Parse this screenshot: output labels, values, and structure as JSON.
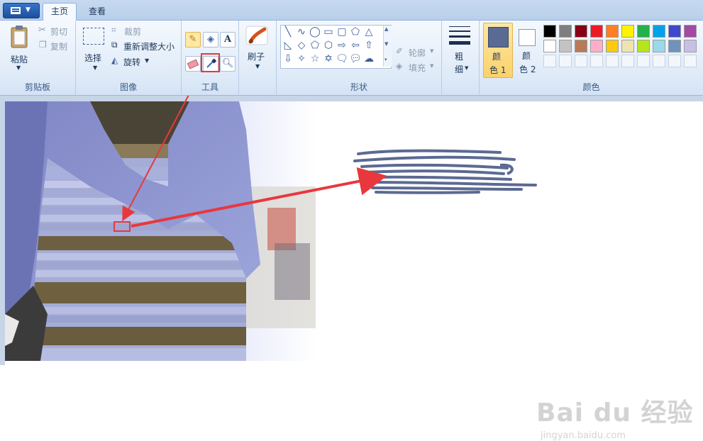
{
  "tabs": [
    {
      "label": "主页",
      "active": true
    },
    {
      "label": "查看",
      "active": false
    }
  ],
  "clipboard": {
    "paste": "粘贴",
    "cut": "剪切",
    "copy": "复制",
    "group": "剪贴板"
  },
  "image": {
    "select": "选择",
    "crop": "裁剪",
    "resize": "重新调整大小",
    "rotate": "旋转",
    "group": "图像"
  },
  "tools": {
    "group": "工具",
    "highlighted_tool": "color-picker"
  },
  "brushes": {
    "label": "刷子"
  },
  "shapes": {
    "outline": "轮廓",
    "fill": "填充",
    "group": "形状"
  },
  "size": {
    "label_top": "粗",
    "label_bottom": "细"
  },
  "colors": {
    "color1_top": "颜",
    "color1_bottom": "色 1",
    "color2_top": "颜",
    "color2_bottom": "色 2",
    "group": "颜色",
    "color1_value": "#5b6a93",
    "color2_value": "#ffffff",
    "palette_row1": [
      "#000000",
      "#7f7f7f",
      "#880015",
      "#ed1c24",
      "#ff7f27",
      "#fff200",
      "#22b14c",
      "#00a2e8",
      "#3f48cc",
      "#a349a4"
    ],
    "palette_row2": [
      "#ffffff",
      "#c3c3c3",
      "#b97a57",
      "#ffaec9",
      "#ffc90e",
      "#efe4b0",
      "#b5e61d",
      "#99d9ea",
      "#7092be",
      "#c8bfe7"
    ]
  },
  "annotation_color": "#e8383d",
  "stroke_color": "#5b6a93",
  "watermark": {
    "brand": "Bai du 经验",
    "url": "jingyan.baidu.com"
  }
}
